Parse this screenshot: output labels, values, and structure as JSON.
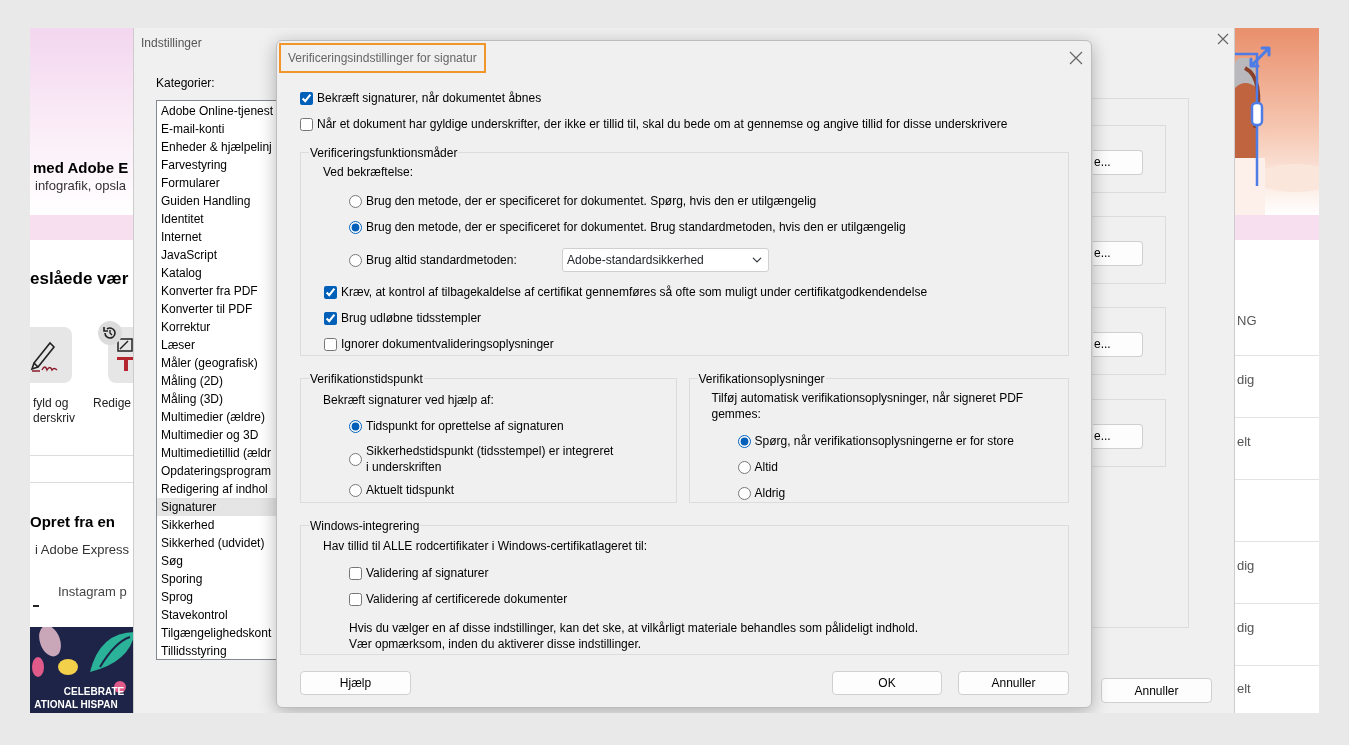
{
  "left_page": {
    "heading": "med Adobe E",
    "subheading": "infografik, opsla",
    "section_title": "eslåede vær",
    "tools": [
      {
        "lines": [
          "fyld og",
          "derskriv"
        ]
      },
      {
        "lines": [
          "Redige"
        ]
      }
    ],
    "section2_title": "Opret fra en",
    "section2_subtitle": "i Adobe Express",
    "tab_label": "Instagram p",
    "banner": {
      "kind": "picture",
      "lines": [
        "CELEBRATE",
        "ATIONAL HISPAN"
      ]
    }
  },
  "right_page": {
    "rows": [
      "NG",
      "dig",
      "elt",
      "dig",
      "dig",
      "elt"
    ]
  },
  "settings_window": {
    "title": "Indstillinger",
    "categories_label": "Kategorier:",
    "categories": [
      {
        "label": "Adobe Online-tjenest",
        "selected": false
      },
      {
        "label": "E-mail-konti",
        "selected": false
      },
      {
        "label": "Enheder & hjælpelinj",
        "selected": false
      },
      {
        "label": "Farvestyring",
        "selected": false
      },
      {
        "label": "Formularer",
        "selected": false
      },
      {
        "label": "Guiden Handling",
        "selected": false
      },
      {
        "label": "Identitet",
        "selected": false
      },
      {
        "label": "Internet",
        "selected": false
      },
      {
        "label": "JavaScript",
        "selected": false
      },
      {
        "label": "Katalog",
        "selected": false
      },
      {
        "label": "Konverter fra PDF",
        "selected": false
      },
      {
        "label": "Konverter til PDF",
        "selected": false
      },
      {
        "label": "Korrektur",
        "selected": false
      },
      {
        "label": "Læser",
        "selected": false
      },
      {
        "label": "Måler (geografisk)",
        "selected": false
      },
      {
        "label": "Måling (2D)",
        "selected": false
      },
      {
        "label": "Måling (3D)",
        "selected": false
      },
      {
        "label": "Multimedier (ældre)",
        "selected": false
      },
      {
        "label": "Multimedier og 3D",
        "selected": false
      },
      {
        "label": "Multimedietillid (ældr",
        "selected": false
      },
      {
        "label": "Opdateringsprogram",
        "selected": false
      },
      {
        "label": "Redigering af indhol",
        "selected": false
      },
      {
        "label": "Signaturer",
        "selected": true
      },
      {
        "label": "Sikkerhed",
        "selected": false
      },
      {
        "label": "Sikkerhed (udvidet)",
        "selected": false
      },
      {
        "label": "Søg",
        "selected": false
      },
      {
        "label": "Sporing",
        "selected": false
      },
      {
        "label": "Sprog",
        "selected": false
      },
      {
        "label": "Stavekontrol",
        "selected": false
      },
      {
        "label": "Tilgængelighedskont",
        "selected": false
      },
      {
        "label": "Tillidsstyring",
        "selected": false
      }
    ],
    "side_buttons": [
      "e...",
      "e...",
      "e...",
      "e..."
    ],
    "cancel_button": "Annuller"
  },
  "dialog": {
    "title": "Verificeringsindstillinger for signatur",
    "title_highlighted": true,
    "top_options": [
      {
        "label": "Bekræft signaturer, når dokumentet åbnes",
        "checked": true
      },
      {
        "label": "Når et dokument har gyldige underskrifter, der ikke er tillid til, skal du bede om at gennemse og angive tillid for disse underskrivere",
        "checked": false
      }
    ],
    "verification_modes": {
      "legend": "Verificeringsfunktionsmåder",
      "prompt": "Ved bekræftelse:",
      "methods": [
        {
          "label": "Brug den metode, der er specificeret for dokumentet. Spørg, hvis den er utilgængelig",
          "selected": false
        },
        {
          "label": "Brug den metode, der er specificeret for dokumentet. Brug standardmetoden, hvis den er utilgængelig",
          "selected": true
        },
        {
          "label": "Brug altid standardmetoden:",
          "selected": false,
          "dropdown": "Adobe-standardsikkerhed"
        }
      ],
      "options": [
        {
          "label": "Kræv, at kontrol af tilbagekaldelse af certifikat gennemføres så ofte som muligt under certifikatgodkendendelse",
          "checked": true
        },
        {
          "label": "Brug udløbne tidsstempler",
          "checked": true
        },
        {
          "label": "Ignorer dokumentvalideringsoplysninger",
          "checked": false
        }
      ]
    },
    "verification_time": {
      "legend": "Verifikationstidspunkt",
      "prompt": "Bekræft signaturer ved hjælp af:",
      "choices": [
        {
          "lines": [
            "Tidspunkt for oprettelse af signaturen"
          ],
          "selected": true
        },
        {
          "lines": [
            "Sikkerhedstidspunkt (tidsstempel) er integreret",
            "i underskriften"
          ],
          "selected": false
        },
        {
          "lines": [
            "Aktuelt tidspunkt"
          ],
          "selected": false
        }
      ]
    },
    "verification_info": {
      "legend": "Verifikationsoplysninger",
      "prompt_lines": [
        "Tilføj automatisk verifikationsoplysninger, når signeret PDF",
        "gemmes:"
      ],
      "choices": [
        {
          "lines": [
            "Spørg, når verifikationsoplysningerne er for store"
          ],
          "selected": true
        },
        {
          "lines": [
            "Altid"
          ],
          "selected": false
        },
        {
          "lines": [
            "Aldrig"
          ],
          "selected": false
        }
      ]
    },
    "windows_integration": {
      "legend": "Windows-integrering",
      "prompt": "Hav tillid til ALLE rodcertifikater i Windows-certifikatlageret til:",
      "options": [
        {
          "label": "Validering af signaturer",
          "checked": false
        },
        {
          "label": "Validering af certificerede dokumenter",
          "checked": false
        }
      ],
      "note_lines": [
        "Hvis du vælger en af disse indstillinger, kan det ske, at vilkårligt materiale behandles som pålideligt indhold.",
        "Vær opmærksom, inden du aktiverer disse indstillinger."
      ]
    },
    "buttons": {
      "help": "Hjælp",
      "ok": "OK",
      "cancel": "Annuller"
    }
  }
}
